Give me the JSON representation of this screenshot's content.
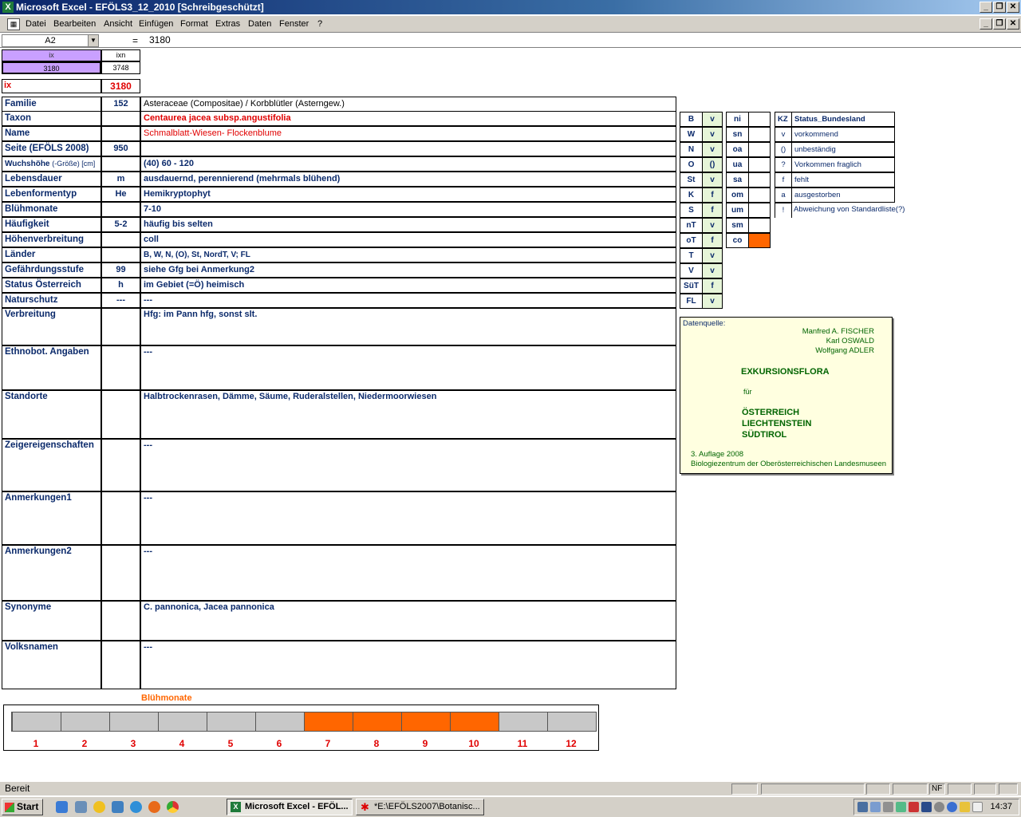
{
  "window": {
    "title": "Microsoft Excel - EFÖLS3_12_2010  [Schreibgeschützt]"
  },
  "menu": {
    "items": [
      "Datei",
      "Bearbeiten",
      "Ansicht",
      "Einfügen",
      "Format",
      "Extras",
      "Daten",
      "Fenster",
      "?"
    ]
  },
  "formula": {
    "namebox": "A2",
    "fx": "=",
    "value": "3180"
  },
  "index": {
    "ix_header": "ix",
    "ixn_header": "ixn",
    "ix_value": "3180",
    "ixn_value": "3748",
    "ix_label": "ix",
    "ix_big": "3180"
  },
  "rows": [
    {
      "label": "Familie",
      "code": "152",
      "value": "Asteraceae (Compositae)  /  Korbblütler (Asterngew.)"
    },
    {
      "label": "Taxon",
      "code": "",
      "value": "Centaurea jacea subsp.angustifolia"
    },
    {
      "label": "Name",
      "code": "",
      "value": "Schmalblatt-Wiesen- Flockenblume"
    },
    {
      "label": "Seite (EFÖLS 2008)",
      "code": "950",
      "value": ""
    },
    {
      "label": "Wuchshöhe",
      "label_suffix": "(-Größe) [cm]",
      "code": "",
      "value": "(40) 60 - 120"
    },
    {
      "label": "Lebensdauer",
      "code": "m",
      "value": "ausdauernd, perennierend (mehrmals blühend)"
    },
    {
      "label": "Lebenformentyp",
      "code": "He",
      "value": "Hemikryptophyt"
    },
    {
      "label": "Blühmonate",
      "code": "",
      "value": "7-10"
    },
    {
      "label": "Häufigkeit",
      "code": "5-2",
      "value": "häufig bis selten"
    },
    {
      "label": "Höhenverbreitung",
      "code": "",
      "value": "coll"
    },
    {
      "label": "Länder",
      "code": "",
      "value": "B, W, N, (O), St, NordT, V; FL"
    },
    {
      "label": "Gefährdungsstufe",
      "code": "99",
      "value": "siehe Gfg bei Anmerkung2"
    },
    {
      "label": "Status Österreich",
      "code": "h",
      "value": "im Gebiet (=Ö) heimisch"
    },
    {
      "label": "Naturschutz",
      "code": "---",
      "value": "---"
    }
  ],
  "tall_rows": [
    {
      "label": "Verbreitung",
      "value": "Hfg: im Pann hfg, sonst slt."
    },
    {
      "label": "Ethnobot. Angaben",
      "value": "---"
    },
    {
      "label": "Standorte",
      "value": "Halbtrockenrasen, Dämme, Säume, Ruderalstellen, Niedermoorwiesen"
    },
    {
      "label": "Zeigereigenschaften",
      "value": "---"
    },
    {
      "label": "Anmerkungen1",
      "value": "---"
    },
    {
      "label": "Anmerkungen2",
      "value": "---"
    },
    {
      "label": "Synonyme",
      "value": "C. pannonica, Jacea pannonica"
    },
    {
      "label": "Volksnamen",
      "value": "---"
    }
  ],
  "bundeslaender": [
    {
      "code": "B",
      "status": "v"
    },
    {
      "code": "W",
      "status": "v"
    },
    {
      "code": "N",
      "status": "v"
    },
    {
      "code": "O",
      "status": "()"
    },
    {
      "code": "St",
      "status": "v"
    },
    {
      "code": "K",
      "status": "f"
    },
    {
      "code": "S",
      "status": "f"
    },
    {
      "code": "nT",
      "status": "v"
    },
    {
      "code": "oT",
      "status": "f"
    },
    {
      "code": "T",
      "status": "v"
    },
    {
      "code": "V",
      "status": "v"
    },
    {
      "code": "SüT",
      "status": "f"
    },
    {
      "code": "FL",
      "status": "v"
    }
  ],
  "hoehenstufen": [
    "ni",
    "sn",
    "oa",
    "ua",
    "sa",
    "om",
    "um",
    "sm",
    "co"
  ],
  "legend": {
    "header_code": "KZ",
    "header_label": "Status_Bundesland",
    "entries": [
      {
        "code": "v",
        "label": "vorkommend"
      },
      {
        "code": "()",
        "label": "unbeständig"
      },
      {
        "code": "?",
        "label": "Vorkommen fraglich"
      },
      {
        "code": "f",
        "label": "fehlt"
      },
      {
        "code": "a",
        "label": "ausgestorben"
      },
      {
        "code": "!",
        "label": "Abweichung von Standardliste(?)"
      }
    ]
  },
  "source": {
    "label": "Datenquelle:",
    "authors": [
      "Manfred A. FISCHER",
      "Karl OSWALD",
      "Wolfgang ADLER"
    ],
    "title": "EXKURSIONSFLORA",
    "fuer": "für",
    "regions": [
      "ÖSTERREICH",
      "LIECHTENSTEIN",
      "SÜDTIROL"
    ],
    "edition": "3. Auflage 2008",
    "publisher": "Biologiezentrum der Oberösterreichischen Landesmuseen"
  },
  "bluehmonate": {
    "title": "Blühmonate",
    "months": [
      "1",
      "2",
      "3",
      "4",
      "5",
      "6",
      "7",
      "8",
      "9",
      "10",
      "11",
      "12"
    ],
    "active_from": 7,
    "active_to": 10,
    "active_color": "#ff6600",
    "inactive_color": "#c8c8c8"
  },
  "status": {
    "text": "Bereit",
    "nf": "NF"
  },
  "taskbar": {
    "start": "Start",
    "task1": "Microsoft Excel - EFÖL...",
    "task2": "*E:\\EFÖLS2007\\Botanisc...",
    "clock": "14:37"
  },
  "colors": {
    "accent_purple": "#c9a0ff",
    "highlight_orange": "#ff6600",
    "green_cell": "#e6f5d8",
    "source_bg": "#ffffe0"
  }
}
